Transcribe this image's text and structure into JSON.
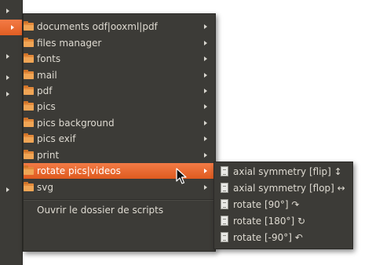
{
  "menu": {
    "items": [
      {
        "label": "documents odf|ooxml|pdf",
        "icon": "folder-icon"
      },
      {
        "label": "files manager",
        "icon": "folder-icon"
      },
      {
        "label": "fonts",
        "icon": "folder-icon"
      },
      {
        "label": "mail",
        "icon": "folder-icon"
      },
      {
        "label": "pdf",
        "icon": "folder-icon"
      },
      {
        "label": "pics",
        "icon": "folder-icon"
      },
      {
        "label": "pics background",
        "icon": "folder-icon"
      },
      {
        "label": "pics exif",
        "icon": "folder-icon"
      },
      {
        "label": "print",
        "icon": "folder-icon"
      },
      {
        "label": "rotate pics|videos",
        "icon": "folder-icon",
        "highlighted": true
      },
      {
        "label": "svg",
        "icon": "folder-icon"
      }
    ],
    "open_scripts_label": "Ouvrir le dossier de scripts"
  },
  "submenu": {
    "items": [
      {
        "label": "axial symmetry [flip] ↕",
        "icon": "document-icon"
      },
      {
        "label": "axial symmetry [flop] ↔",
        "icon": "document-icon"
      },
      {
        "label": "rotate [90°] ↷",
        "icon": "document-icon"
      },
      {
        "label": "rotate [180°] ↻",
        "icon": "document-icon"
      },
      {
        "label": "rotate [-90°] ↶",
        "icon": "document-icon"
      }
    ]
  },
  "colors": {
    "menu_bg": "#3c3b37",
    "highlight": "#e86a30",
    "text": "#dfdbd2",
    "folder": "#e2893b"
  }
}
